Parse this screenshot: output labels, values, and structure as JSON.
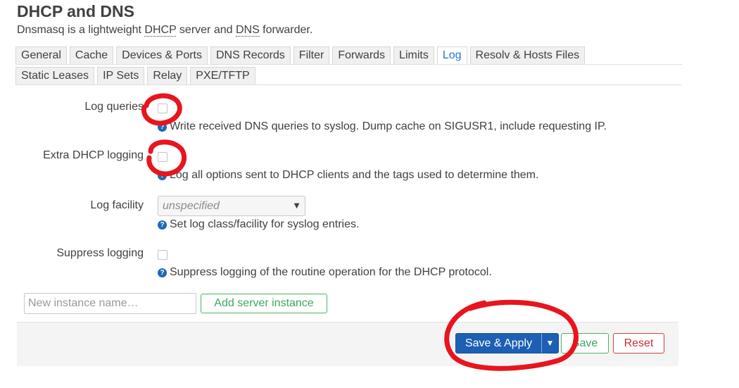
{
  "page": {
    "title": "DHCP and DNS",
    "description_parts": [
      "Dnsmasq is a lightweight ",
      "DHCP",
      " server and ",
      "DNS",
      " forwarder."
    ]
  },
  "tabs": {
    "row1": [
      "General",
      "Cache",
      "Devices & Ports",
      "DNS Records",
      "Filter",
      "Forwards",
      "Limits",
      "Log",
      "Resolv & Hosts Files"
    ],
    "row2": [
      "Static Leases",
      "IP Sets",
      "Relay",
      "PXE/TFTP"
    ],
    "active": "Log"
  },
  "fields": {
    "log_queries": {
      "label": "Log queries",
      "checked": false,
      "help": "Write received DNS queries to syslog. Dump cache on SIGUSR1, include requesting IP."
    },
    "extra_dhcp_logging": {
      "label": "Extra DHCP logging",
      "checked": false,
      "help": "Log all options sent to DHCP clients and the tags used to determine them."
    },
    "log_facility": {
      "label": "Log facility",
      "selected": "unspecified",
      "help": "Set log class/facility for syslog entries."
    },
    "suppress_logging": {
      "label": "Suppress logging",
      "checked": false,
      "help": "Suppress logging of the routine operation for the DHCP protocol."
    }
  },
  "instance": {
    "placeholder": "New instance name…",
    "add_label": "Add server instance"
  },
  "actions": {
    "save_apply": "Save & Apply",
    "save": "Save",
    "reset": "Reset"
  },
  "icons": {
    "help": "question-circle-icon",
    "dropdown": "caret-down-icon"
  },
  "colors": {
    "accent_blue": "#1c5fb4",
    "active_tab": "#1f78c8",
    "positive_green": "#3aa860",
    "negative_red": "#c83232",
    "annotation_red": "#e8141e"
  }
}
